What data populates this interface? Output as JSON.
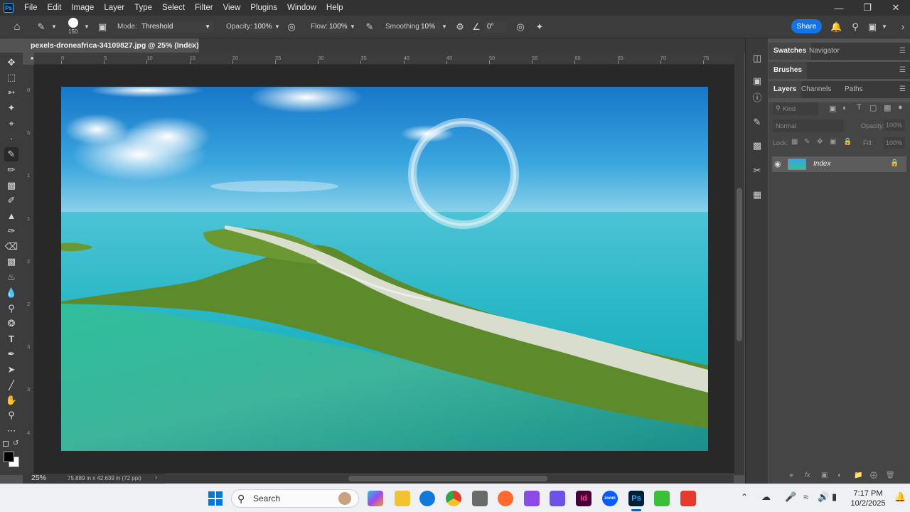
{
  "app": {
    "logo": "Ps"
  },
  "menu": [
    "File",
    "Edit",
    "Image",
    "Layer",
    "Type",
    "Select",
    "Filter",
    "View",
    "Plugins",
    "Window",
    "Help"
  ],
  "options": {
    "brush_size": "150",
    "mode_label": "Mode:",
    "mode_value": "Threshold",
    "opacity_label": "Opacity:",
    "opacity_value": "100%",
    "flow_label": "Flow:",
    "flow_value": "100%",
    "smoothing_label": "Smoothing:",
    "smoothing_value": "10%",
    "angle_value": "0°",
    "share_label": "Share"
  },
  "document": {
    "tab_title": "pexels-droneafrica-34109827.jpg @ 25% (Index) *",
    "zoom": "25%",
    "dimensions": "75.889 in x 42.639 in (72 ppi)",
    "ruler_top": [
      "0",
      "5",
      "10",
      "15",
      "20",
      "25",
      "30",
      "35",
      "40",
      "45",
      "50",
      "55",
      "60",
      "65",
      "70",
      "75"
    ],
    "ruler_left": [
      "0",
      "5",
      "1",
      "1",
      "2",
      "2",
      "3",
      "3",
      "4"
    ]
  },
  "panels": {
    "top_tabs": [
      "Swatches",
      "Navigator"
    ],
    "brushes_tab": "Brushes",
    "layer_tabs": [
      "Layers",
      "Channels",
      "Paths"
    ],
    "kind_placeholder": "Kind",
    "blend_mode": "Normal",
    "opacity_label": "Opacity:",
    "opacity_value": "100%",
    "lock_label": "Lock:",
    "fill_label": "Fill:",
    "fill_value": "100%",
    "layer_name": "Index"
  },
  "taskbar": {
    "search_label": "Search",
    "time": "7:17 PM",
    "date": "10/2/2025"
  },
  "colors": {
    "accent": "#1473e6",
    "panel": "#535353",
    "dark": "#323232"
  }
}
